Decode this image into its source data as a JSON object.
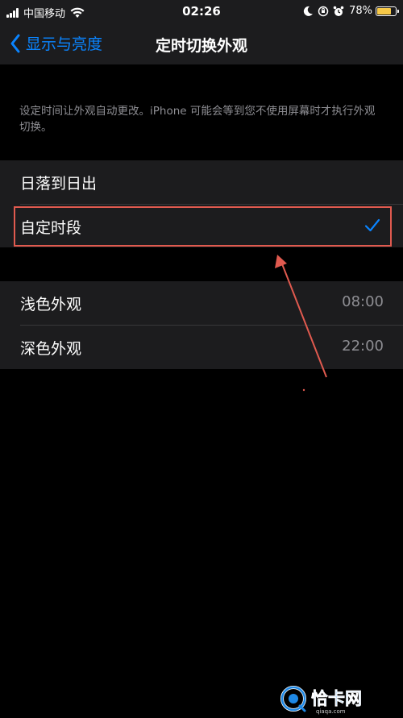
{
  "status_bar": {
    "carrier": "中国移动",
    "time": "02:26",
    "battery_percent": "78%",
    "battery_level": 0.78,
    "icons": [
      "signal-icon",
      "wifi-icon",
      "moon-icon",
      "orientation-lock-icon",
      "alarm-icon",
      "battery-icon"
    ]
  },
  "nav": {
    "back_label": "显示与亮度",
    "title": "定时切换外观"
  },
  "description": "设定时间让外观自动更改。iPhone 可能会等到您不使用屏幕时才执行外观切换。",
  "schedule_options": [
    {
      "label": "日落到日出",
      "selected": false
    },
    {
      "label": "自定时段",
      "selected": true
    }
  ],
  "custom_schedule": [
    {
      "label": "浅色外观",
      "value": "08:00"
    },
    {
      "label": "深色外观",
      "value": "22:00"
    }
  ],
  "colors": {
    "accent": "#0a84ff",
    "annotation": "#e05a4f",
    "cell_background": "#1c1c1e",
    "secondary_text": "#8e8e93"
  },
  "watermark": {
    "brand": "恰卡网",
    "url": "qiaqa.com"
  }
}
